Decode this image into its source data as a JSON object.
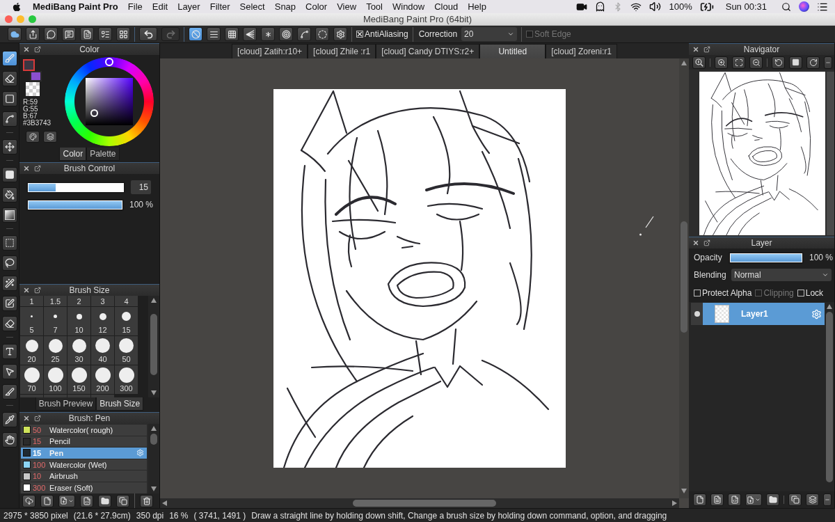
{
  "menu_bar": {
    "app_name": "MediBang Paint Pro",
    "menus": [
      "File",
      "Edit",
      "Layer",
      "Filter",
      "Select",
      "Snap",
      "Color",
      "View",
      "Tool",
      "Window",
      "Cloud",
      "Help"
    ],
    "battery": "100%",
    "clock": "Sun 00:31"
  },
  "window": {
    "title": "MediBang Paint Pro (64bit)"
  },
  "toolbar": {
    "history": [
      {
        "kind": "undo",
        "disabled": false
      },
      {
        "kind": "redo",
        "disabled": true
      }
    ],
    "snap_modes": [
      {
        "kind": "off",
        "selected": true
      },
      {
        "kind": "parallel",
        "selected": false
      },
      {
        "kind": "grid",
        "selected": false
      },
      {
        "kind": "perspective",
        "selected": false
      },
      {
        "kind": "radial",
        "selected": false
      },
      {
        "kind": "concentric",
        "selected": false
      },
      {
        "kind": "curve",
        "selected": false
      },
      {
        "kind": "ellipse",
        "selected": false
      },
      {
        "kind": "settings",
        "selected": false
      }
    ],
    "antialiasing": {
      "label": "AntiAliasing",
      "checked": true
    },
    "correction": {
      "label": "Correction",
      "value": "20"
    },
    "soft_edge": {
      "label": "Soft Edge",
      "checked": false,
      "disabled": true
    }
  },
  "tool_groups": [
    [
      {
        "kind": "brush",
        "selected": true
      },
      {
        "kind": "eraser",
        "selected": false
      },
      {
        "kind": "dot",
        "selected": false
      },
      {
        "kind": "vector",
        "selected": false
      }
    ],
    [
      {
        "kind": "move",
        "selected": false
      }
    ],
    [
      {
        "kind": "fill",
        "selected": false
      },
      {
        "kind": "bucket",
        "selected": false
      },
      {
        "kind": "gradient",
        "selected": false
      }
    ],
    [
      {
        "kind": "select",
        "selected": false
      },
      {
        "kind": "lasso",
        "selected": false
      },
      {
        "kind": "wand",
        "selected": false
      },
      {
        "kind": "select_pen",
        "selected": false
      },
      {
        "kind": "select_eraser",
        "selected": false
      }
    ],
    [
      {
        "kind": "text",
        "selected": false
      },
      {
        "kind": "operation",
        "selected": false
      },
      {
        "kind": "divide",
        "selected": false
      }
    ],
    [
      {
        "kind": "eyedropper",
        "selected": false
      },
      {
        "kind": "hand",
        "selected": false
      }
    ]
  ],
  "color_panel": {
    "title": "Color",
    "swatches": [
      {
        "kind": "primary",
        "color": "#3b3743",
        "selected": true
      },
      {
        "kind": "secondary",
        "color": "#8b4fcf",
        "selected": false
      }
    ],
    "channels": [
      "R:59",
      "G:55",
      "B:67"
    ],
    "hex": "#3B3743",
    "tabs": [
      {
        "label": "Color",
        "selected": true
      },
      {
        "label": "Palette",
        "selected": false
      }
    ]
  },
  "brush_control": {
    "title": "Brush Control",
    "size": {
      "level": 0.29,
      "value": "15"
    },
    "opacity": {
      "level": 1,
      "reading": "100 %"
    }
  },
  "brush_size": {
    "title": "Brush Size",
    "sizes": [
      "1",
      "1.5",
      "2",
      "3",
      "4",
      "5",
      "7",
      "10",
      "12",
      "15",
      "20",
      "25",
      "30",
      "40",
      "50",
      "70",
      "100",
      "150",
      "200",
      "300"
    ],
    "tabs": [
      {
        "label": "Brush Preview",
        "selected": false
      },
      {
        "label": "Brush Size",
        "selected": true
      }
    ]
  },
  "brush_list": {
    "title": "Brush: Pen",
    "items": [
      {
        "color": "#cfe35b",
        "size": "50",
        "name": "Watercolor( rough)",
        "selected": false
      },
      {
        "color": "#2b2b2b",
        "size": "15",
        "name": "Pencil",
        "selected": false
      },
      {
        "color": "#1f2a33",
        "size": "15",
        "name": "Pen",
        "selected": true
      },
      {
        "color": "#8cd4f4",
        "size": "100",
        "name": "Watercolor (Wet)",
        "selected": false
      },
      {
        "color": "#c8c8c8",
        "size": "10",
        "name": "Airbrush",
        "selected": false
      },
      {
        "color": "#ffffff",
        "size": "300",
        "name": "Eraser (Soft)",
        "selected": false
      }
    ]
  },
  "canvas_tabs": [
    {
      "label": "[cloud] Zatih:r10+",
      "selected": false
    },
    {
      "label": "[cloud] Zhile :r1",
      "selected": false
    },
    {
      "label": "[cloud] Candy DTIYS:r2+",
      "selected": false
    },
    {
      "label": "Untitled",
      "selected": true
    },
    {
      "label": "[cloud] Zoreni:r1",
      "selected": false
    }
  ],
  "navigator": {
    "title": "Navigator"
  },
  "layer_panel": {
    "title": "Layer",
    "opacity": {
      "label": "Opacity",
      "level": 1,
      "reading": "100 %"
    },
    "blending": {
      "label": "Blending",
      "value": "Normal"
    },
    "options": [
      {
        "label": "Protect Alpha",
        "checked": false,
        "disabled": false
      },
      {
        "label": "Clipping",
        "checked": false,
        "disabled": true
      },
      {
        "label": "Lock",
        "checked": false,
        "disabled": false
      }
    ],
    "layers": [
      {
        "name": "Layer1",
        "visible": true,
        "selected": true
      }
    ]
  },
  "status_bar": {
    "image_size": "2975 * 3850 pixel",
    "print_size": "(21.6 * 27.9cm)",
    "resolution": "350 dpi",
    "zoom": "16 %",
    "cursor": "( 3741, 1491 )",
    "hint": "Draw a straight line by holding down shift, Change a brush size by holding down command, option, and dragging"
  }
}
